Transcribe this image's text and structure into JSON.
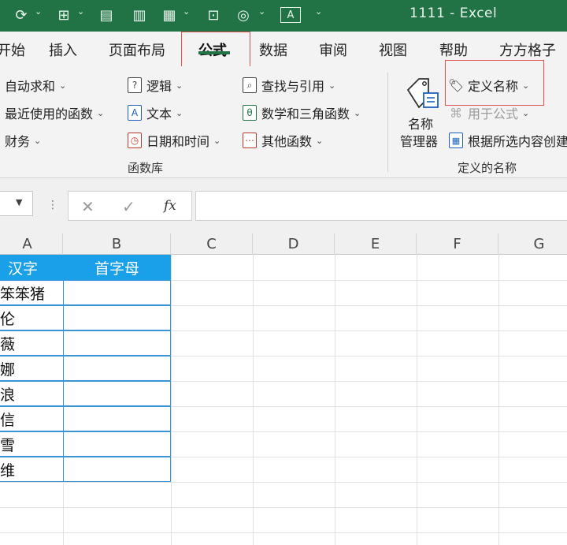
{
  "title_bar": {
    "document_title": "1111  -  Excel",
    "quick_access": [
      {
        "name": "redo-icon",
        "glyph": "⟳"
      },
      {
        "name": "borders-icon",
        "glyph": "⊞"
      },
      {
        "name": "form-icon",
        "glyph": "▤"
      },
      {
        "name": "chart-icon",
        "glyph": "▥"
      },
      {
        "name": "pivot-icon",
        "glyph": "▦"
      },
      {
        "name": "camera-icon",
        "glyph": "⊡"
      },
      {
        "name": "shapes-icon",
        "glyph": "◎"
      },
      {
        "name": "textbox-icon",
        "glyph": "A"
      }
    ],
    "colors": {
      "bar": "#217346"
    }
  },
  "ribbon": {
    "tabs": [
      "开始",
      "插入",
      "页面布局",
      "公式",
      "数据",
      "审阅",
      "视图",
      "帮助",
      "方方格子"
    ],
    "active_tab": "公式",
    "function_library": {
      "items": [
        {
          "label": "自动求和",
          "icon": "sum-icon",
          "glyph": "Σ"
        },
        {
          "label": "最近使用的函数",
          "icon": "recent-icon",
          "glyph": "★"
        },
        {
          "label": "财务",
          "icon": "finance-icon",
          "glyph": "¥"
        },
        {
          "label": "逻辑",
          "icon": "logic-icon",
          "glyph": "?"
        },
        {
          "label": "文本",
          "icon": "text-icon",
          "glyph": "A"
        },
        {
          "label": "日期和时间",
          "icon": "clock-icon",
          "glyph": "◷"
        },
        {
          "label": "查找与引用",
          "icon": "lookup-icon",
          "glyph": "⌕"
        },
        {
          "label": "数学和三角函数",
          "icon": "math-icon",
          "glyph": "θ"
        },
        {
          "label": "其他函数",
          "icon": "more-functions-icon",
          "glyph": "⋯"
        }
      ],
      "group_label": "函数库"
    },
    "defined_names": {
      "name_manager": [
        "名称",
        "管理器"
      ],
      "define_name": "定义名称",
      "use_in_formula": "用于公式",
      "create_from_selection": "根据所选内容创建",
      "group_label": "定义的名称"
    },
    "highlight_color": "#e0524b"
  },
  "formula_bar": {
    "cancel_glyph": "✕",
    "enter_glyph": "✓",
    "fx_label": "fx",
    "formula": ""
  },
  "sheet": {
    "columns": [
      "A",
      "B",
      "C",
      "D",
      "E",
      "F",
      "G"
    ],
    "header_row": [
      "汉字",
      "首字母"
    ],
    "rows": [
      [
        "的笨笨猪",
        ""
      ],
      [
        "小伦",
        ""
      ],
      [
        "青薇",
        ""
      ],
      [
        "蓓娜",
        ""
      ],
      [
        "流浪",
        ""
      ],
      [
        "纵信",
        ""
      ],
      [
        "飞雪",
        ""
      ],
      [
        "阿维",
        ""
      ]
    ],
    "header_fill": "#1aa0e8"
  }
}
